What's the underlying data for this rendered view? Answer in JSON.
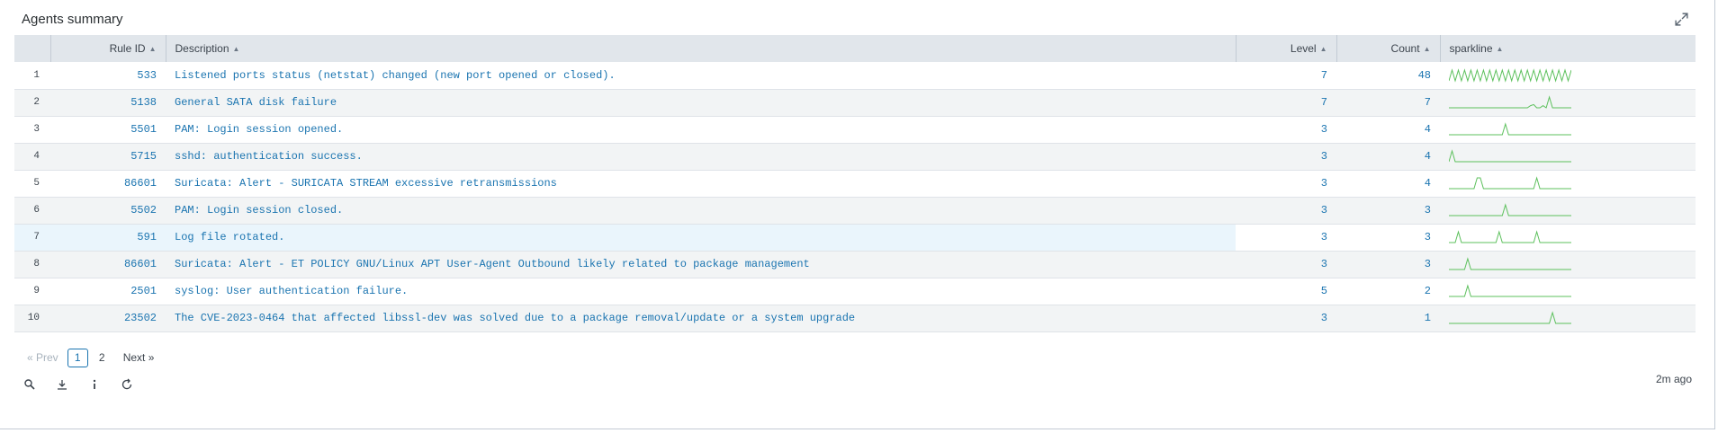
{
  "panel": {
    "title": "Agents summary",
    "expand_icon": "expand-icon",
    "last_updated": "2m ago"
  },
  "table": {
    "columns": [
      {
        "label": ""
      },
      {
        "label": "Rule ID"
      },
      {
        "label": "Description"
      },
      {
        "label": "Level"
      },
      {
        "label": "Count"
      },
      {
        "label": "sparkline"
      }
    ],
    "rows": [
      {
        "index": "1",
        "rule_id": "533",
        "description": "Listened ports status (netstat) changed (new port opened or closed).",
        "level": "7",
        "count": "48",
        "sparkline": [
          0,
          1,
          0,
          1,
          0,
          1,
          0,
          1,
          0,
          1,
          0,
          1,
          0,
          1,
          0,
          1,
          0,
          1,
          0,
          1,
          0,
          1,
          0,
          1,
          0,
          1,
          0,
          1,
          0,
          1,
          0,
          1,
          0,
          1,
          0,
          1,
          0,
          1,
          0,
          1
        ]
      },
      {
        "index": "2",
        "rule_id": "5138",
        "description": "General SATA disk failure",
        "level": "7",
        "count": "7",
        "sparkline": [
          0,
          0,
          0,
          0,
          0,
          0,
          0,
          0,
          0,
          0,
          0,
          0,
          0,
          0,
          0,
          0,
          0,
          0,
          0,
          0,
          0,
          0,
          0,
          0,
          0,
          0,
          0.2,
          0.3,
          0,
          0,
          0.2,
          0,
          1,
          0,
          0,
          0,
          0,
          0,
          0,
          0
        ]
      },
      {
        "index": "3",
        "rule_id": "5501",
        "description": "PAM: Login session opened.",
        "level": "3",
        "count": "4",
        "sparkline": [
          0,
          0,
          0,
          0,
          0,
          0,
          0,
          0,
          0,
          0,
          0,
          0,
          0,
          0,
          0,
          0,
          0,
          0,
          1,
          0,
          0,
          0,
          0,
          0,
          0,
          0,
          0,
          0,
          0,
          0,
          0,
          0,
          0,
          0,
          0,
          0,
          0,
          0,
          0,
          0
        ]
      },
      {
        "index": "4",
        "rule_id": "5715",
        "description": "sshd: authentication success.",
        "level": "3",
        "count": "4",
        "sparkline": [
          0,
          1,
          0,
          0,
          0,
          0,
          0,
          0,
          0,
          0,
          0,
          0,
          0,
          0,
          0,
          0,
          0,
          0,
          0,
          0,
          0,
          0,
          0,
          0,
          0,
          0,
          0,
          0,
          0,
          0,
          0,
          0,
          0,
          0,
          0,
          0,
          0,
          0,
          0,
          0
        ]
      },
      {
        "index": "5",
        "rule_id": "86601",
        "description": "Suricata: Alert - SURICATA STREAM excessive retransmissions",
        "level": "3",
        "count": "4",
        "sparkline": [
          0,
          0,
          0,
          0,
          0,
          0,
          0,
          0,
          0,
          1,
          1,
          0,
          0,
          0,
          0,
          0,
          0,
          0,
          0,
          0,
          0,
          0,
          0,
          0,
          0,
          0,
          0,
          0,
          1,
          0,
          0,
          0,
          0,
          0,
          0,
          0,
          0,
          0,
          0,
          0
        ]
      },
      {
        "index": "6",
        "rule_id": "5502",
        "description": "PAM: Login session closed.",
        "level": "3",
        "count": "3",
        "sparkline": [
          0,
          0,
          0,
          0,
          0,
          0,
          0,
          0,
          0,
          0,
          0,
          0,
          0,
          0,
          0,
          0,
          0,
          0,
          1,
          0,
          0,
          0,
          0,
          0,
          0,
          0,
          0,
          0,
          0,
          0,
          0,
          0,
          0,
          0,
          0,
          0,
          0,
          0,
          0,
          0
        ]
      },
      {
        "index": "7",
        "rule_id": "591",
        "description": "Log file rotated.",
        "level": "3",
        "count": "3",
        "sparkline": [
          0,
          0,
          0,
          1,
          0,
          0,
          0,
          0,
          0,
          0,
          0,
          0,
          0,
          0,
          0,
          0,
          1,
          0,
          0,
          0,
          0,
          0,
          0,
          0,
          0,
          0,
          0,
          0,
          1,
          0,
          0,
          0,
          0,
          0,
          0,
          0,
          0,
          0,
          0,
          0
        ]
      },
      {
        "index": "8",
        "rule_id": "86601",
        "description": "Suricata: Alert - ET POLICY GNU/Linux APT User-Agent Outbound likely related to package management",
        "level": "3",
        "count": "3",
        "sparkline": [
          0,
          0,
          0,
          0,
          0,
          0,
          1,
          0,
          0,
          0,
          0,
          0,
          0,
          0,
          0,
          0,
          0,
          0,
          0,
          0,
          0,
          0,
          0,
          0,
          0,
          0,
          0,
          0,
          0,
          0,
          0,
          0,
          0,
          0,
          0,
          0,
          0,
          0,
          0,
          0
        ]
      },
      {
        "index": "9",
        "rule_id": "2501",
        "description": "syslog: User authentication failure.",
        "level": "5",
        "count": "2",
        "sparkline": [
          0,
          0,
          0,
          0,
          0,
          0,
          1,
          0,
          0,
          0,
          0,
          0,
          0,
          0,
          0,
          0,
          0,
          0,
          0,
          0,
          0,
          0,
          0,
          0,
          0,
          0,
          0,
          0,
          0,
          0,
          0,
          0,
          0,
          0,
          0,
          0,
          0,
          0,
          0,
          0
        ]
      },
      {
        "index": "10",
        "rule_id": "23502",
        "description": "The CVE-2023-0464 that affected libssl-dev was solved due to a package removal/update or a system upgrade",
        "level": "3",
        "count": "1",
        "sparkline": [
          0,
          0,
          0,
          0,
          0,
          0,
          0,
          0,
          0,
          0,
          0,
          0,
          0,
          0,
          0,
          0,
          0,
          0,
          0,
          0,
          0,
          0,
          0,
          0,
          0,
          0,
          0,
          0,
          0,
          0,
          0,
          0,
          0,
          1,
          0,
          0,
          0,
          0,
          0,
          0
        ]
      }
    ]
  },
  "pagination": {
    "prev": "« Prev",
    "pages": [
      "1",
      "2"
    ],
    "current": "1",
    "next": "Next »"
  },
  "toolbar": {
    "icons": [
      "search-icon",
      "download-icon",
      "info-icon",
      "refresh-icon"
    ]
  },
  "colors": {
    "link": "#1a74b0",
    "sparkline": "#5cc05c",
    "header_bg": "#e1e6eb",
    "highlight_row": "#eaf5fc"
  }
}
